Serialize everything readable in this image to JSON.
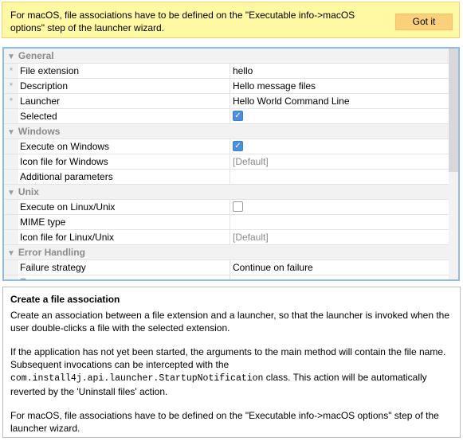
{
  "banner": {
    "text": "For macOS, file associations have to be defined on the \"Executable info->macOS options\" step of the launcher wizard.",
    "button_label": "Got it",
    "background_color": "#fff9a4",
    "button_color": "#fbd07a"
  },
  "properties": {
    "groups": [
      {
        "name": "General",
        "rows": [
          {
            "label": "File extension",
            "required": true,
            "type": "text",
            "value": "hello"
          },
          {
            "label": "Description",
            "required": true,
            "type": "text",
            "value": "Hello message files"
          },
          {
            "label": "Launcher",
            "required": true,
            "type": "text",
            "value": "Hello World Command Line"
          },
          {
            "label": "Selected",
            "required": false,
            "type": "checkbox",
            "checked": true
          }
        ]
      },
      {
        "name": "Windows",
        "rows": [
          {
            "label": "Execute on Windows",
            "required": false,
            "type": "checkbox",
            "checked": true
          },
          {
            "label": "Icon file for Windows",
            "required": false,
            "type": "placeholder",
            "value": "[Default]"
          },
          {
            "label": "Additional parameters",
            "required": false,
            "type": "text",
            "value": ""
          }
        ]
      },
      {
        "name": "Unix",
        "rows": [
          {
            "label": "Execute on Linux/Unix",
            "required": false,
            "type": "checkbox",
            "checked": false
          },
          {
            "label": "MIME type",
            "required": false,
            "type": "text",
            "value": ""
          },
          {
            "label": "Icon file for Linux/Unix",
            "required": false,
            "type": "placeholder",
            "value": "[Default]"
          }
        ]
      },
      {
        "name": "Error Handling",
        "rows": [
          {
            "label": "Failure strategy",
            "required": false,
            "type": "text",
            "value": "Continue on failure"
          },
          {
            "label": "E",
            "required": false,
            "type": "text",
            "value": ""
          }
        ]
      }
    ],
    "required_marker": "*",
    "expanded_marker": "▼",
    "check_glyph": "✓",
    "checkbox_color": "#4a90dd",
    "border_color": "#8fbde6"
  },
  "help": {
    "title": "Create a file association",
    "paragraph1": "Create an association between a file extension and a launcher, so that the launcher is invoked when the user double-clicks a file with the selected extension.",
    "paragraph2_prefix": "If the application has not yet been started, the arguments to the main method will contain the file name. Subsequent invocations can be intercepted with the ",
    "paragraph2_code": "com.install4j.api.launcher.StartupNotification",
    "paragraph2_suffix": " class. This action will be automatically reverted by the 'Uninstall files' action.",
    "paragraph3": "For macOS, file associations have to be defined on the \"Executable info->macOS options\" step of the launcher wizard."
  }
}
